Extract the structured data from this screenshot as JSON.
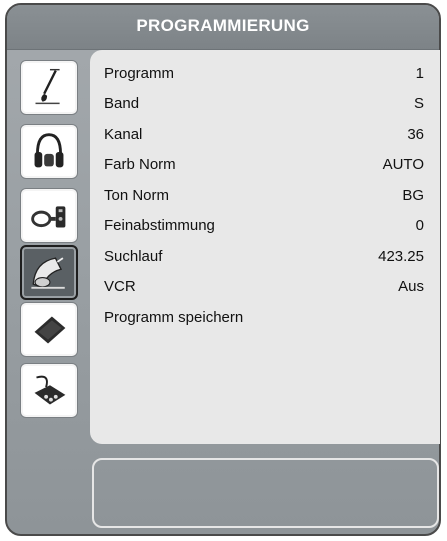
{
  "title": "PROGRAMMIERUNG",
  "sidebar": {
    "tabs": [
      {
        "id": "picture",
        "icon": "paint-brush-icon",
        "active": false
      },
      {
        "id": "sound",
        "icon": "headphones-icon",
        "active": false
      },
      {
        "id": "features",
        "icon": "remote-key-icon",
        "active": false
      },
      {
        "id": "install",
        "icon": "satellite-dish-icon",
        "active": true
      },
      {
        "id": "source",
        "icon": "source-card-icon",
        "active": false
      },
      {
        "id": "connections",
        "icon": "connector-plug-icon",
        "active": false
      }
    ]
  },
  "menu": {
    "items": [
      {
        "label": "Programm",
        "value": "1"
      },
      {
        "label": "Band",
        "value": "S"
      },
      {
        "label": "Kanal",
        "value": "36"
      },
      {
        "label": "Farb Norm",
        "value": "AUTO"
      },
      {
        "label": "Ton Norm",
        "value": "BG"
      },
      {
        "label": "Feinabstimmung",
        "value": "0"
      },
      {
        "label": "Suchlauf",
        "value": "423.25"
      },
      {
        "label": "VCR",
        "value": "Aus"
      },
      {
        "label": "Programm speichern",
        "value": ""
      }
    ]
  },
  "info_box": {
    "text": ""
  },
  "colors": {
    "background": "#9aa0a4",
    "panel": "#e8e8e8",
    "title_text": "#ffffff",
    "active_tab": "#5a6064"
  }
}
